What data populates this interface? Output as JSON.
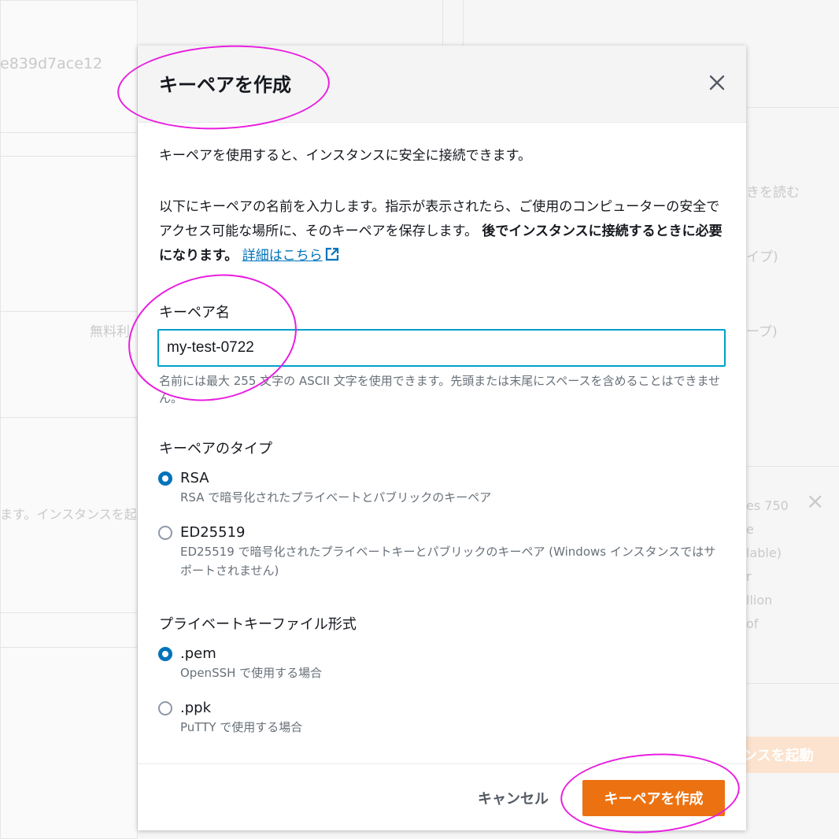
{
  "background": {
    "id_fragment": "e839d7ace12",
    "read_more": "きを読む",
    "type_suffix_1": "イプ)",
    "type_suffix_2": "ープ)",
    "free_label": "無料利",
    "launch_hint": "ます。インスタンスを起動",
    "right_lines": [
      "es 750",
      "e",
      "lable)",
      "r",
      "llion",
      "of"
    ],
    "launch_button": "ンスを起動"
  },
  "modal": {
    "title": "キーペアを作成",
    "intro": "キーペアを使用すると、インスタンスに安全に接続できます。",
    "instructions": "以下にキーペアの名前を入力します。指示が表示されたら、ご使用のコンピューターの安全でアクセス可能な場所に、そのキーペアを保存します。",
    "instructions_bold": "後でインスタンスに接続するときに必要になります。",
    "details_link": "詳細はこちら",
    "key_name": {
      "label": "キーペア名",
      "value": "my-test-0722",
      "hint": "名前には最大 255 文字の ASCII 文字を使用できます。先頭または末尾にスペースを含めることはできません。"
    },
    "key_type": {
      "label": "キーペアのタイプ",
      "options": [
        {
          "title": "RSA",
          "desc": "RSA で暗号化されたプライベートとパブリックのキーペア",
          "checked": true
        },
        {
          "title": "ED25519",
          "desc": "ED25519 で暗号化されたプライベートキーとパブリックのキーペア (Windows インスタンスではサポートされません)",
          "checked": false
        }
      ]
    },
    "file_format": {
      "label": "プライベートキーファイル形式",
      "options": [
        {
          "title": ".pem",
          "desc": "OpenSSH で使用する場合",
          "checked": true
        },
        {
          "title": ".ppk",
          "desc": "PuTTY で使用する場合",
          "checked": false
        }
      ]
    },
    "cancel_label": "キャンセル",
    "create_label": "キーペアを作成"
  },
  "colors": {
    "accent": "#0073bb",
    "primary_button": "#ec7211",
    "annotation": "#e81ee0",
    "focus_border": "#00a1c9"
  }
}
